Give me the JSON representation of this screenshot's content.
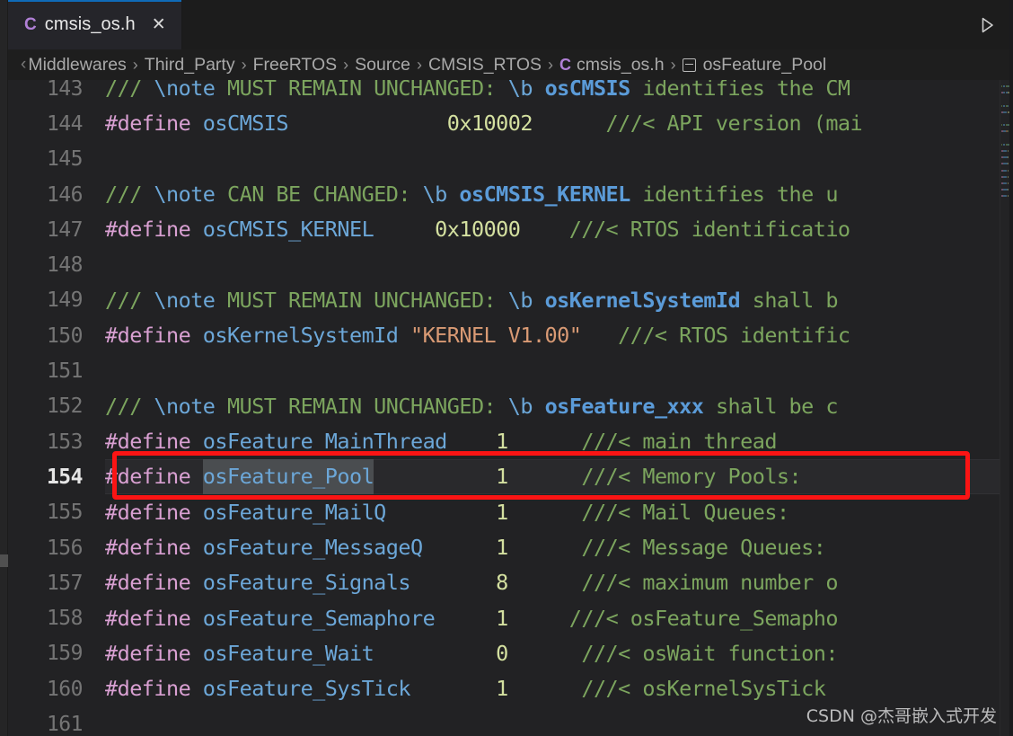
{
  "window": {
    "theme": "dark",
    "accent_blue": "#0f6bb8",
    "editor_bg": "#222224",
    "tab_bg": "#25252a"
  },
  "tabs": [
    {
      "label": "cmsis_os.h",
      "file_icon": "C",
      "active": true,
      "close_glyph": "✕"
    }
  ],
  "editor_actions": {
    "run_label": "Run",
    "run_icon": "play-triangle-icon"
  },
  "breadcrumb": {
    "clipped_prefix": "‹",
    "separator": "›",
    "items": [
      {
        "label": "Middlewares",
        "icon": null
      },
      {
        "label": "Third_Party",
        "icon": null
      },
      {
        "label": "FreeRTOS",
        "icon": null
      },
      {
        "label": "Source",
        "icon": null
      },
      {
        "label": "CMSIS_RTOS",
        "icon": null
      },
      {
        "label": "cmsis_os.h",
        "icon": "c-file-icon"
      },
      {
        "label": "osFeature_Pool",
        "icon": "symbol-constant-icon"
      }
    ]
  },
  "code": {
    "language": "c",
    "first_line": 143,
    "active_line": 154,
    "selection_text": "osFeature_Pool",
    "lines": [
      {
        "no": 143,
        "tokens": [
          {
            "t": "/// ",
            "c": "t-cmt"
          },
          {
            "t": "\\note ",
            "c": "t-doc"
          },
          {
            "t": "MUST REMAIN UNCHANGED: ",
            "c": "t-cmt"
          },
          {
            "t": "\\b ",
            "c": "t-doc"
          },
          {
            "t": "osCMSIS",
            "c": "t-docb"
          },
          {
            "t": " identifies the CM",
            "c": "t-cmt"
          }
        ]
      },
      {
        "no": 144,
        "tokens": [
          {
            "t": "#define ",
            "c": "t-pre"
          },
          {
            "t": "osCMSIS",
            "c": "t-id"
          },
          {
            "t": "             ",
            "c": "t-id"
          },
          {
            "t": "0x10002",
            "c": "t-num"
          },
          {
            "t": "      ",
            "c": "t-cmt"
          },
          {
            "t": "///< API version (mai",
            "c": "t-cmt"
          }
        ]
      },
      {
        "no": 145,
        "tokens": []
      },
      {
        "no": 146,
        "tokens": [
          {
            "t": "/// ",
            "c": "t-cmt"
          },
          {
            "t": "\\note ",
            "c": "t-doc"
          },
          {
            "t": "CAN BE CHANGED: ",
            "c": "t-cmt"
          },
          {
            "t": "\\b ",
            "c": "t-doc"
          },
          {
            "t": "osCMSIS_KERNEL",
            "c": "t-docb"
          },
          {
            "t": " identifies the u",
            "c": "t-cmt"
          }
        ]
      },
      {
        "no": 147,
        "tokens": [
          {
            "t": "#define ",
            "c": "t-pre"
          },
          {
            "t": "osCMSIS_KERNEL",
            "c": "t-id"
          },
          {
            "t": "     ",
            "c": "t-id"
          },
          {
            "t": "0x10000",
            "c": "t-num"
          },
          {
            "t": "    ",
            "c": "t-cmt"
          },
          {
            "t": "///< RTOS identificatio",
            "c": "t-cmt"
          }
        ]
      },
      {
        "no": 148,
        "tokens": []
      },
      {
        "no": 149,
        "tokens": [
          {
            "t": "/// ",
            "c": "t-cmt"
          },
          {
            "t": "\\note ",
            "c": "t-doc"
          },
          {
            "t": "MUST REMAIN UNCHANGED: ",
            "c": "t-cmt"
          },
          {
            "t": "\\b ",
            "c": "t-doc"
          },
          {
            "t": "osKernelSystemId",
            "c": "t-docb"
          },
          {
            "t": " shall b",
            "c": "t-cmt"
          }
        ]
      },
      {
        "no": 150,
        "tokens": [
          {
            "t": "#define ",
            "c": "t-pre"
          },
          {
            "t": "osKernelSystemId ",
            "c": "t-id"
          },
          {
            "t": "\"KERNEL V1.00\"",
            "c": "t-str"
          },
          {
            "t": "   ",
            "c": "t-cmt"
          },
          {
            "t": "///< RTOS identific",
            "c": "t-cmt"
          }
        ]
      },
      {
        "no": 151,
        "tokens": []
      },
      {
        "no": 152,
        "tokens": [
          {
            "t": "/// ",
            "c": "t-cmt"
          },
          {
            "t": "\\note ",
            "c": "t-doc"
          },
          {
            "t": "MUST REMAIN UNCHANGED: ",
            "c": "t-cmt"
          },
          {
            "t": "\\b ",
            "c": "t-doc"
          },
          {
            "t": "osFeature_xxx",
            "c": "t-docb"
          },
          {
            "t": " shall be c",
            "c": "t-cmt"
          }
        ]
      },
      {
        "no": 153,
        "tokens": [
          {
            "t": "#define ",
            "c": "t-pre"
          },
          {
            "t": "osFeature_MainThread",
            "c": "t-id"
          },
          {
            "t": "    ",
            "c": "t-id"
          },
          {
            "t": "1",
            "c": "t-num"
          },
          {
            "t": "      ",
            "c": "t-cmt"
          },
          {
            "t": "///< main thread",
            "c": "t-cmt"
          }
        ]
      },
      {
        "no": 154,
        "current": true,
        "tokens": [
          {
            "t": "#define ",
            "c": "t-pre"
          },
          {
            "t": "osFeature_Pool",
            "c": "t-id",
            "sel": true
          },
          {
            "t": "          ",
            "c": "t-id"
          },
          {
            "t": "1",
            "c": "t-num"
          },
          {
            "t": "      ",
            "c": "t-cmt"
          },
          {
            "t": "///< Memory Pools:",
            "c": "t-cmt"
          }
        ]
      },
      {
        "no": 155,
        "tokens": [
          {
            "t": "#define ",
            "c": "t-pre"
          },
          {
            "t": "osFeature_MailQ",
            "c": "t-id"
          },
          {
            "t": "         ",
            "c": "t-id"
          },
          {
            "t": "1",
            "c": "t-num"
          },
          {
            "t": "      ",
            "c": "t-cmt"
          },
          {
            "t": "///< Mail Queues:",
            "c": "t-cmt"
          }
        ]
      },
      {
        "no": 156,
        "tokens": [
          {
            "t": "#define ",
            "c": "t-pre"
          },
          {
            "t": "osFeature_MessageQ",
            "c": "t-id"
          },
          {
            "t": "      ",
            "c": "t-id"
          },
          {
            "t": "1",
            "c": "t-num"
          },
          {
            "t": "      ",
            "c": "t-cmt"
          },
          {
            "t": "///< Message Queues:",
            "c": "t-cmt"
          }
        ]
      },
      {
        "no": 157,
        "tokens": [
          {
            "t": "#define ",
            "c": "t-pre"
          },
          {
            "t": "osFeature_Signals",
            "c": "t-id"
          },
          {
            "t": "       ",
            "c": "t-id"
          },
          {
            "t": "8",
            "c": "t-num"
          },
          {
            "t": "      ",
            "c": "t-cmt"
          },
          {
            "t": "///< maximum number o",
            "c": "t-cmt"
          }
        ]
      },
      {
        "no": 158,
        "tokens": [
          {
            "t": "#define ",
            "c": "t-pre"
          },
          {
            "t": "osFeature_Semaphore",
            "c": "t-id"
          },
          {
            "t": "     ",
            "c": "t-id"
          },
          {
            "t": "1",
            "c": "t-num"
          },
          {
            "t": "     ",
            "c": "t-cmt"
          },
          {
            "t": "///< osFeature_Semapho",
            "c": "t-cmt"
          }
        ]
      },
      {
        "no": 159,
        "tokens": [
          {
            "t": "#define ",
            "c": "t-pre"
          },
          {
            "t": "osFeature_Wait",
            "c": "t-id"
          },
          {
            "t": "          ",
            "c": "t-id"
          },
          {
            "t": "0",
            "c": "t-num"
          },
          {
            "t": "      ",
            "c": "t-cmt"
          },
          {
            "t": "///< osWait function:",
            "c": "t-cmt"
          }
        ]
      },
      {
        "no": 160,
        "tokens": [
          {
            "t": "#define ",
            "c": "t-pre"
          },
          {
            "t": "osFeature_SysTick",
            "c": "t-id"
          },
          {
            "t": "       ",
            "c": "t-id"
          },
          {
            "t": "1",
            "c": "t-num"
          },
          {
            "t": "      ",
            "c": "t-cmt"
          },
          {
            "t": "///< osKernelSysTick ",
            "c": "t-cmt"
          }
        ]
      },
      {
        "no": 161,
        "tokens": []
      }
    ]
  },
  "annotation": {
    "type": "red-rectangle",
    "color": "#fb1414",
    "targets_line": 154
  },
  "watermark": {
    "text": "CSDN @杰哥嵌入式开发"
  }
}
